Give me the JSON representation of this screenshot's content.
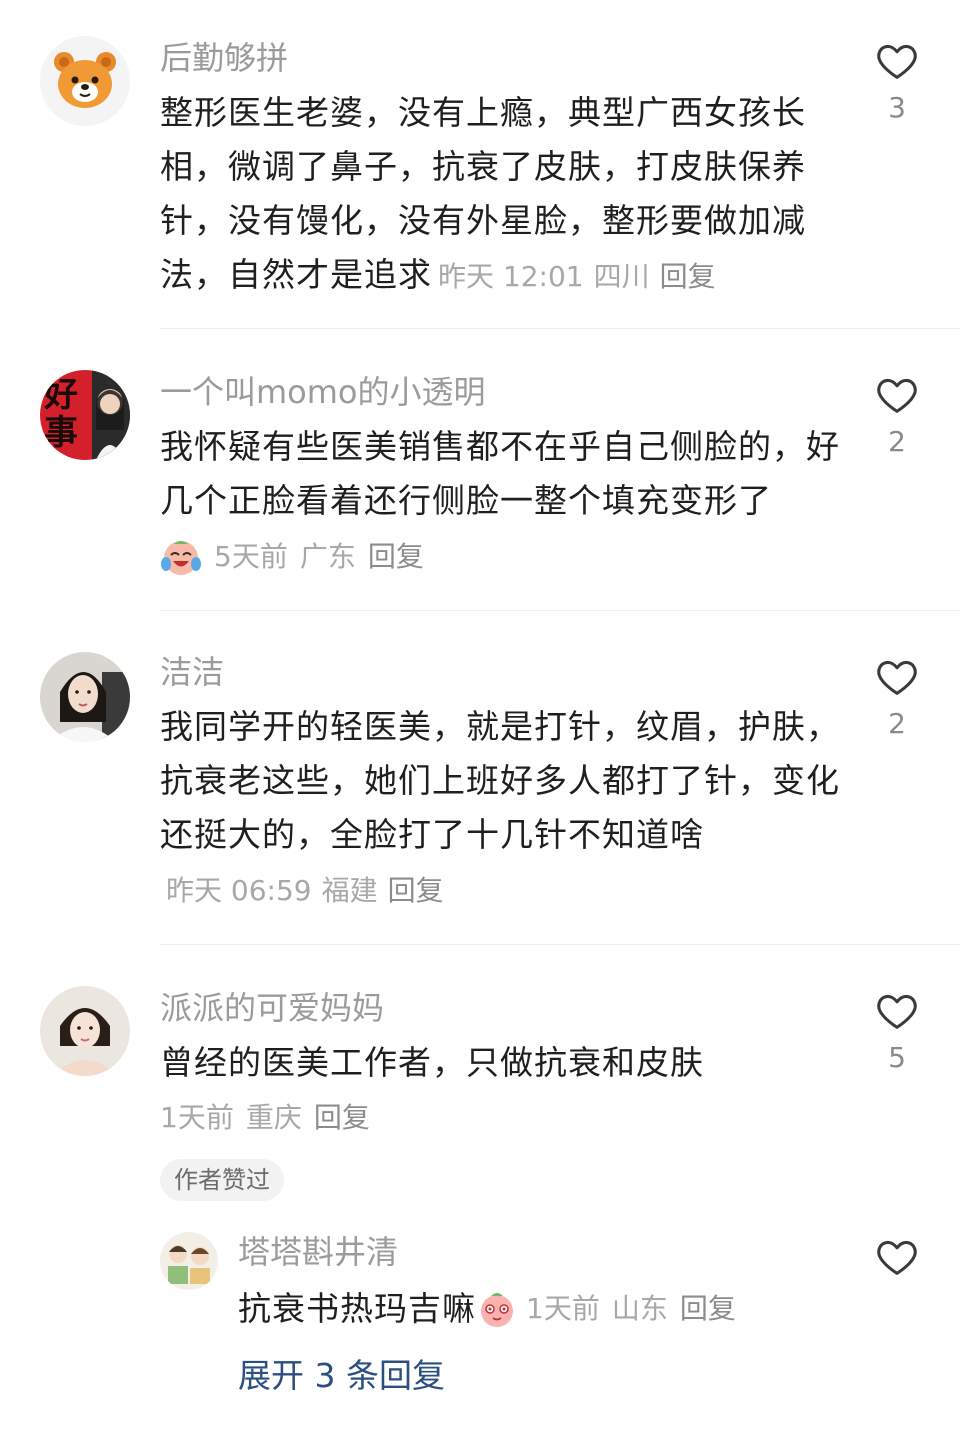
{
  "comments": [
    {
      "username": "后勤够拼",
      "text": "整形医生老婆，没有上瘾，典型广西女孩长相，微调了鼻子，抗衰了皮肤，打皮肤保养针，没有馒化，没有外星脸，整形要做加减法，自然才是追求",
      "time": "昨天 12:01",
      "location": "四川",
      "reply_label": "回复",
      "like_count": "3",
      "avatar_icon": "bear-avatar-icon"
    },
    {
      "username": "一个叫momo的小透明",
      "text": "我怀疑有些医美销售都不在乎自己侧脸的，好几个正脸看着还行侧脸一整个填充变形了",
      "time": "5天前",
      "location": "广东",
      "reply_label": "回复",
      "like_count": "2",
      "avatar_text": "好事",
      "emoji": "crying-laugh-emoji"
    },
    {
      "username": "洁洁",
      "text": "我同学开的轻医美，就是打针，纹眉，护肤，抗衰老这些，她们上班好多人都打了针，变化还挺大的，全脸打了十几针不知道啥",
      "time": "昨天 06:59",
      "location": "福建",
      "reply_label": "回复",
      "like_count": "2"
    },
    {
      "username": "派派的可爱妈妈",
      "text": "曾经的医美工作者，只做抗衰和皮肤",
      "time": "1天前",
      "location": "重庆",
      "reply_label": "回复",
      "like_count": "5",
      "badge": "作者赞过"
    }
  ],
  "reply": {
    "username": "塔塔斟井清",
    "text": "抗衰书热玛吉嘛",
    "time": "1天前",
    "location": "山东",
    "reply_label": "回复",
    "emoji": "cute-face-emoji"
  },
  "expand_label": "展开 3 条回复",
  "colors": {
    "username": "#9b9b9b",
    "meta": "#a8a8a8",
    "expand": "#2a4f80",
    "text": "#1f1f1f"
  }
}
